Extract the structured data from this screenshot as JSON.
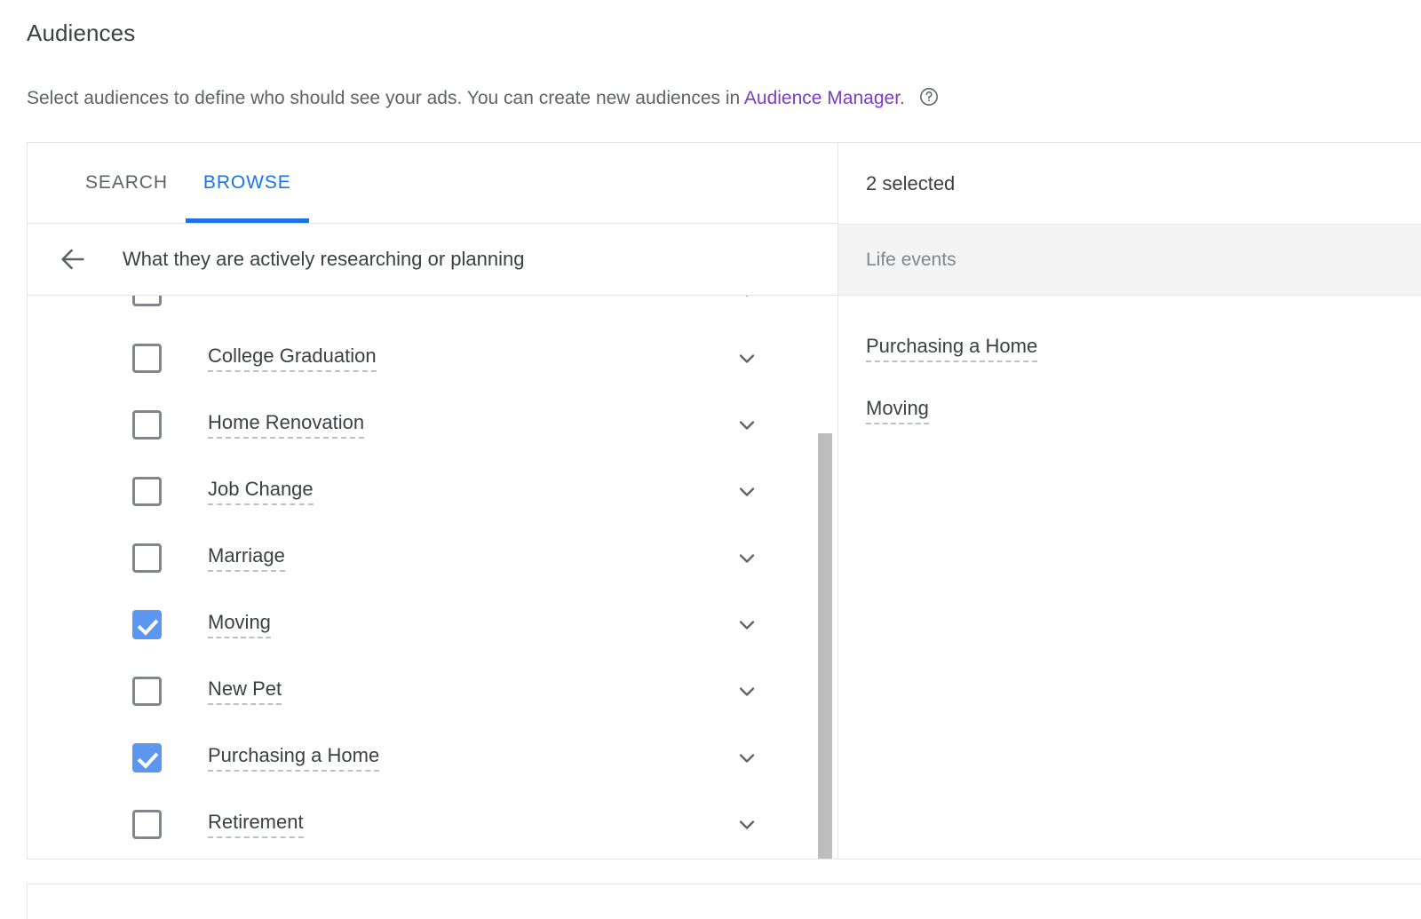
{
  "page": {
    "title": "Audiences",
    "description_before_link": "Select audiences to define who should see your ads. You can create new audiences in ",
    "link_text": "Audience Manager",
    "description_after_link": ".",
    "help_icon": "help-circle-icon"
  },
  "tabs": [
    {
      "label": "SEARCH",
      "active": false
    },
    {
      "label": "BROWSE",
      "active": true
    }
  ],
  "breadcrumb": {
    "back_icon": "arrow-left-icon",
    "label": "What they are actively researching or planning"
  },
  "browse_list": {
    "expand_icon": "chevron-down-icon",
    "items": [
      {
        "label": "",
        "checked": false,
        "clipped": true
      },
      {
        "label": "College Graduation",
        "checked": false
      },
      {
        "label": "Home Renovation",
        "checked": false
      },
      {
        "label": "Job Change",
        "checked": false
      },
      {
        "label": "Marriage",
        "checked": false
      },
      {
        "label": "Moving",
        "checked": true
      },
      {
        "label": "New Pet",
        "checked": false
      },
      {
        "label": "Purchasing a Home",
        "checked": true
      },
      {
        "label": "Retirement",
        "checked": false
      }
    ]
  },
  "selected_panel": {
    "count_label": "2 selected",
    "groups": [
      {
        "name": "Life events",
        "items": [
          "Purchasing a Home",
          "Moving"
        ]
      }
    ]
  },
  "colors": {
    "accent_blue": "#1a73e8",
    "checkbox_blue": "#5c96f0",
    "link_purple": "#7b3ec2",
    "text_primary": "#3c4043",
    "text_secondary": "#5f6368",
    "group_header_bg": "#f4f4f4",
    "scrollbar_thumb": "#bdbdbd"
  }
}
